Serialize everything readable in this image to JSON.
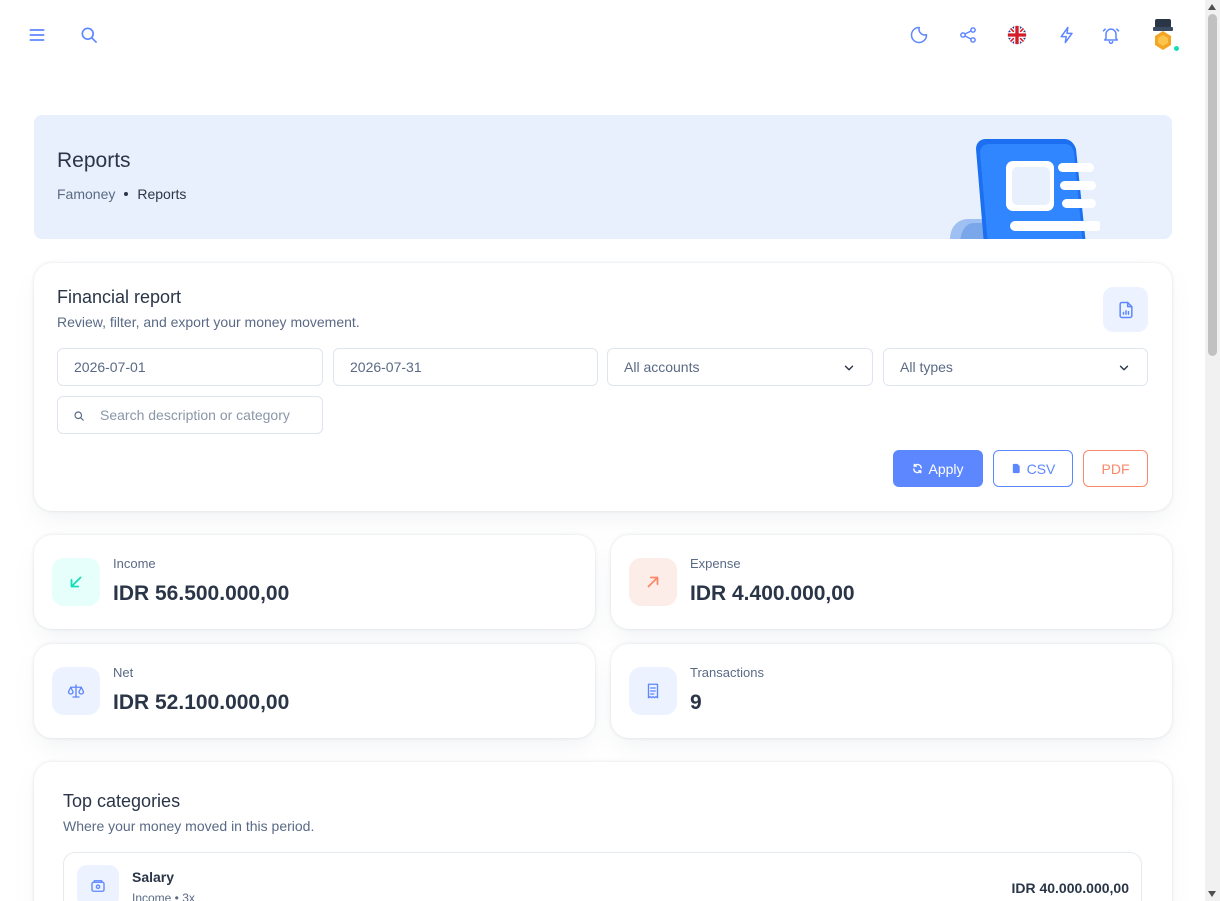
{
  "colors": {
    "primary": "#5d87ff",
    "success": "#13deb9",
    "warning": "#fa896b",
    "text": "#2a3547",
    "muted": "#5a6a85",
    "banner_bg": "#e8f0fd"
  },
  "topbar": {
    "icons": [
      "menu-icon",
      "search-icon",
      "moon-icon",
      "share-icon",
      "uk-flag-icon",
      "bolt-icon",
      "bell-icon",
      "avatar"
    ]
  },
  "page": {
    "title": "Reports",
    "breadcrumb": [
      "Famoney",
      "Reports"
    ]
  },
  "report": {
    "title": "Financial report",
    "subtitle": "Review, filter, and export your money movement.",
    "date_from": "2026-07-01",
    "date_to": "2026-07-31",
    "account_select": "All accounts",
    "type_select": "All types",
    "search_placeholder": "Search description or category",
    "apply_label": "Apply",
    "csv_label": "CSV",
    "pdf_label": "PDF"
  },
  "stats": {
    "income": {
      "label": "Income",
      "value": "IDR 56.500.000,00"
    },
    "expense": {
      "label": "Expense",
      "value": "IDR 4.400.000,00"
    },
    "net": {
      "label": "Net",
      "value": "IDR 52.100.000,00"
    },
    "transactions": {
      "label": "Transactions",
      "value": "9"
    }
  },
  "categories": {
    "title": "Top categories",
    "subtitle": "Where your money moved in this period.",
    "items": [
      {
        "name": "Salary",
        "meta": "Income • 3x",
        "amount": "IDR 40.000.000,00"
      }
    ]
  }
}
